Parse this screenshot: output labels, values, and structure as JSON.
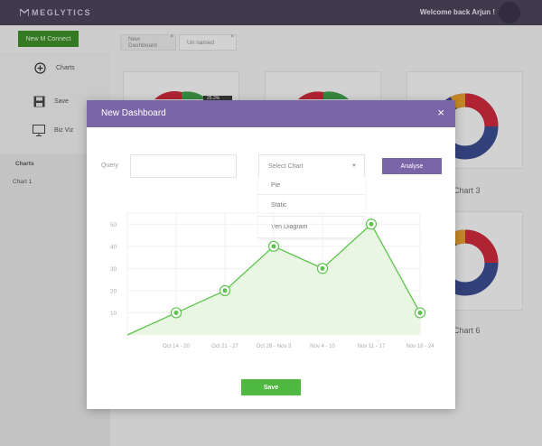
{
  "app": {
    "logo_text": "MEGLYTICS",
    "welcome": "Welcome back Arjun !"
  },
  "toolbar": {
    "connect_label": "New M Connect"
  },
  "tabs": [
    {
      "label": "New Dashboard",
      "close": "×"
    },
    {
      "label": "Un named",
      "close": "×"
    }
  ],
  "sidebar": {
    "items": [
      {
        "label": "Charts",
        "icon": "plus-circle-icon"
      },
      {
        "label": "Save",
        "icon": "floppy-disk-icon"
      },
      {
        "label": "Biz Viz",
        "icon": "monitor-icon"
      }
    ],
    "section_title": "Charts",
    "chart_items": [
      "Chart 1"
    ]
  },
  "cards": {
    "chart3_title": "Chart 3",
    "chart6_title": "Chart 6",
    "badge": "25.3%"
  },
  "modal": {
    "title": "New Dashboard",
    "close": "×",
    "query_label": "Query",
    "query_value": "",
    "select_placeholder": "Select  Chart",
    "select_arrow": "▼",
    "dropdown_options": [
      "Pie",
      "Static",
      "Ven Diagram"
    ],
    "analyse_label": "Analyse",
    "save_label": "Save"
  },
  "colors": {
    "brand_purple": "#7a66a6",
    "topbar": "#4a4258",
    "green": "#4fb840",
    "line_green": "#5cc44a",
    "donut_red": "#c8283a",
    "donut_blue": "#3b4a8c",
    "donut_orange": "#e09a2c"
  },
  "chart_data": {
    "type": "area",
    "categories": [
      "",
      "Oct 14 - 20",
      "Oct 21 - 27",
      "Oct 28 - Nov 3",
      "Nov 4 - 10",
      "Nov 11 - 17",
      "Nov 18 - 24"
    ],
    "values": [
      0,
      10,
      20,
      40,
      30,
      50,
      10
    ],
    "y_ticks": [
      10,
      20,
      30,
      40,
      50
    ],
    "ylim": [
      0,
      55
    ],
    "grid": true,
    "title": "",
    "xlabel": "",
    "ylabel": ""
  }
}
